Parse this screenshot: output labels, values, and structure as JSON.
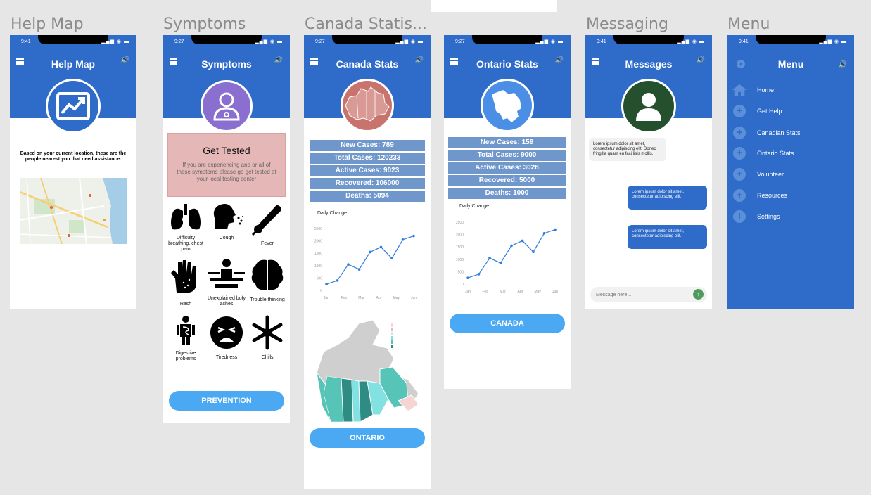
{
  "frame_titles": [
    "Help Map",
    "Symptoms",
    "Canada Statis...",
    "",
    "Messaging",
    "Menu"
  ],
  "times": {
    "help_map": "9:41",
    "symptoms": "9:27",
    "canada": "9:27",
    "ontario": "9:27",
    "messages": "9:41",
    "menu": "9:41"
  },
  "help_map": {
    "title": "Help Map",
    "description": "Based on your current location, these are the people nearest you that need assistance."
  },
  "symptoms": {
    "title": "Symptoms",
    "card_title": "Get Tested",
    "card_text": "If you are experiencing and or all of these symptoms please go get tested at your local testing center",
    "items": [
      "Difficulty breathing, chest pain",
      "Cough",
      "Fever",
      "Rash",
      "Unexplained bofy aches",
      "Trouble thinking",
      "Digestive problems",
      "Tiredness",
      "Chills"
    ],
    "button": "PREVENTION"
  },
  "canada": {
    "title": "Canada Stats",
    "stats": [
      "New Cases: 789",
      "Total Cases: 120233",
      "Active Cases: 9023",
      "Recovered: 106000",
      "Deaths:  5094"
    ],
    "chart_title": "Daily Change",
    "button": "ONTARIO"
  },
  "ontario": {
    "title": "Ontario Stats",
    "stats": [
      "New Cases:  159",
      "Total Cases:  9000",
      "Active Cases: 3028",
      "Recovered:  5000",
      "Deaths: 1000"
    ],
    "chart_title": "Daily Change",
    "button": "CANADA"
  },
  "messages": {
    "title": "Messages",
    "incoming": "Lorem ipsum dolor sit amet, consectetur adipiscing elit. Donec fringilla quam eu faci lisis mollis.",
    "outgoing": [
      "Lorem ipsum dolor sit amet, consectetur adipiscing elit.",
      "Lorem ipsum dolor sit amet, consectetur adipiscing elit."
    ],
    "input_placeholder": "Message here..."
  },
  "menu": {
    "title": "Menu",
    "items": [
      "Home",
      "Get Help",
      "Canadian Stats",
      "Ontario Stats",
      "Volunteer",
      "Resources",
      "Settings"
    ]
  },
  "chart_data": [
    {
      "type": "line",
      "title": "Daily Change",
      "categories": [
        "Jan",
        "Feb",
        "Mar",
        "Apr",
        "May",
        "Jun"
      ],
      "y_ticks": [
        "0",
        "500",
        "1000",
        "1500",
        "2000",
        "2500"
      ],
      "values": [
        250,
        400,
        1050,
        850,
        1550,
        1750,
        1300,
        2050,
        2200
      ],
      "ylim": [
        0,
        2500
      ]
    },
    {
      "type": "line",
      "title": "Daily Change",
      "categories": [
        "Jan",
        "Feb",
        "Mar",
        "Apr",
        "May",
        "Jun"
      ],
      "y_ticks": [
        "0",
        "500",
        "1000",
        "1500",
        "2000",
        "2500"
      ],
      "values": [
        250,
        400,
        1050,
        850,
        1550,
        1750,
        1300,
        2050,
        2200
      ],
      "ylim": [
        0,
        2500
      ]
    }
  ],
  "colors": {
    "header": "#2f6bc8",
    "button": "#4aa9f2",
    "stat_row": "#6f97cc",
    "symptoms_avatar": "#8a6fd0",
    "canada_avatar": "#c9736f",
    "message_avatar": "#25502e"
  }
}
